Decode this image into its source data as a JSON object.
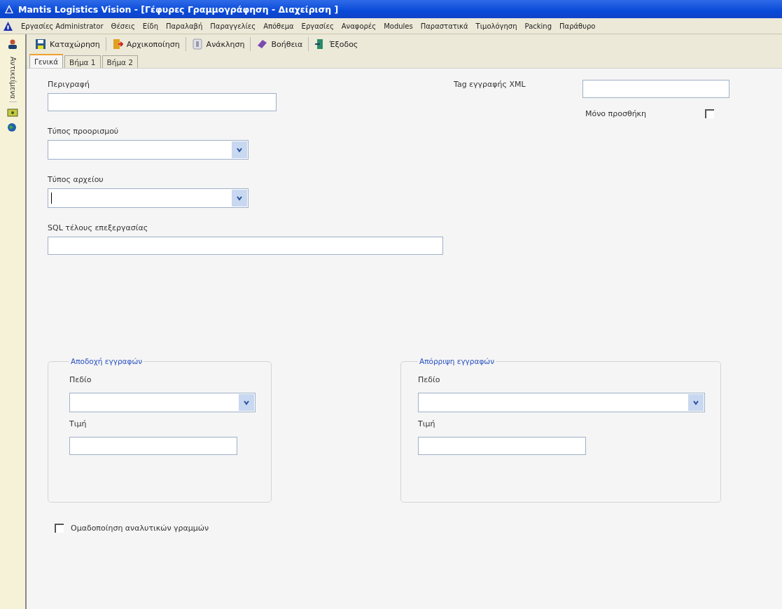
{
  "window": {
    "title": "Mantis Logistics Vision - [Γέφυρες Γραμμογράφηση - Διαχείριση  ]"
  },
  "menu": [
    "Εργασίες Administrator",
    "Θέσεις",
    "Είδη",
    "Παραλαβή",
    "Παραγγελίες",
    "Απόθεμα",
    "Εργασίες",
    "Αναφορές",
    "Modules",
    "Παραστατικά",
    "Τιμολόγηση",
    "Packing",
    "Παράθυρο"
  ],
  "side_panel": {
    "label": "Αντικείμενα"
  },
  "toolbar": [
    {
      "kind": "save",
      "label": "Καταχώρηση"
    },
    {
      "kind": "reset",
      "label": "Αρχικοποίηση"
    },
    {
      "kind": "refresh",
      "label": "Ανάκληση"
    },
    {
      "kind": "help",
      "label": "Βοήθεια"
    },
    {
      "kind": "exit",
      "label": "Έξοδος"
    }
  ],
  "tabs": [
    {
      "label": "Γενικά",
      "selected": true
    },
    {
      "label": "Βήμα 1",
      "selected": false
    },
    {
      "label": "Βήμα 2",
      "selected": false
    }
  ],
  "form": {
    "description": {
      "label": "Περιγραφή"
    },
    "destination_type": {
      "label": "Τύπος προορισμού"
    },
    "file_type": {
      "label": "Τύπος αρχείου"
    },
    "sql": {
      "label": "SQL τέλους επεξεργασίας"
    },
    "xml_tag": {
      "label": "Tag εγγραφής XML"
    },
    "append_only": {
      "label": "Μόνο προσθήκη",
      "checked": false
    }
  },
  "groups": [
    {
      "title": "Αποδοχή εγγραφών",
      "field_label": "Πεδίο",
      "value_label": "Τιμή"
    },
    {
      "title": "Απόρριψη εγγραφών",
      "field_label": "Πεδίο",
      "value_label": "Τιμή"
    }
  ],
  "group_lines": {
    "label": "Ομαδοποίηση αναλυτικών γραμμών",
    "checked": false
  }
}
